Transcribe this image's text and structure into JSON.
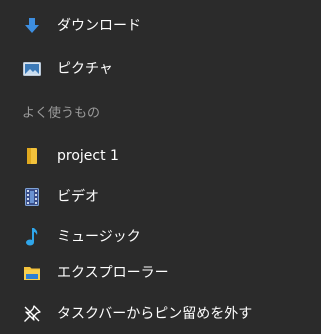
{
  "menu": {
    "top_items": [
      {
        "label": "ダウンロード",
        "icon": "download-arrow-icon"
      },
      {
        "label": "ピクチャ",
        "icon": "pictures-icon"
      }
    ],
    "section_header": "よく使うもの",
    "pinned_items": [
      {
        "label": "project 1",
        "icon": "folder-icon"
      },
      {
        "label": "ビデオ",
        "icon": "video-icon"
      },
      {
        "label": "ミュージック",
        "icon": "music-note-icon"
      },
      {
        "label": "エクスプローラー",
        "icon": "file-explorer-icon"
      },
      {
        "label": "タスクバーからピン留めを外す",
        "icon": "unpin-icon"
      }
    ]
  },
  "colors": {
    "background": "#2b2b2b",
    "text": "#ffffff",
    "muted_text": "#9a9a9a",
    "download_blue": "#3d8ee0",
    "folder_yellow": "#f3c23b",
    "music_blue": "#2fa6ea",
    "explorer_blue": "#2d7fd3"
  }
}
